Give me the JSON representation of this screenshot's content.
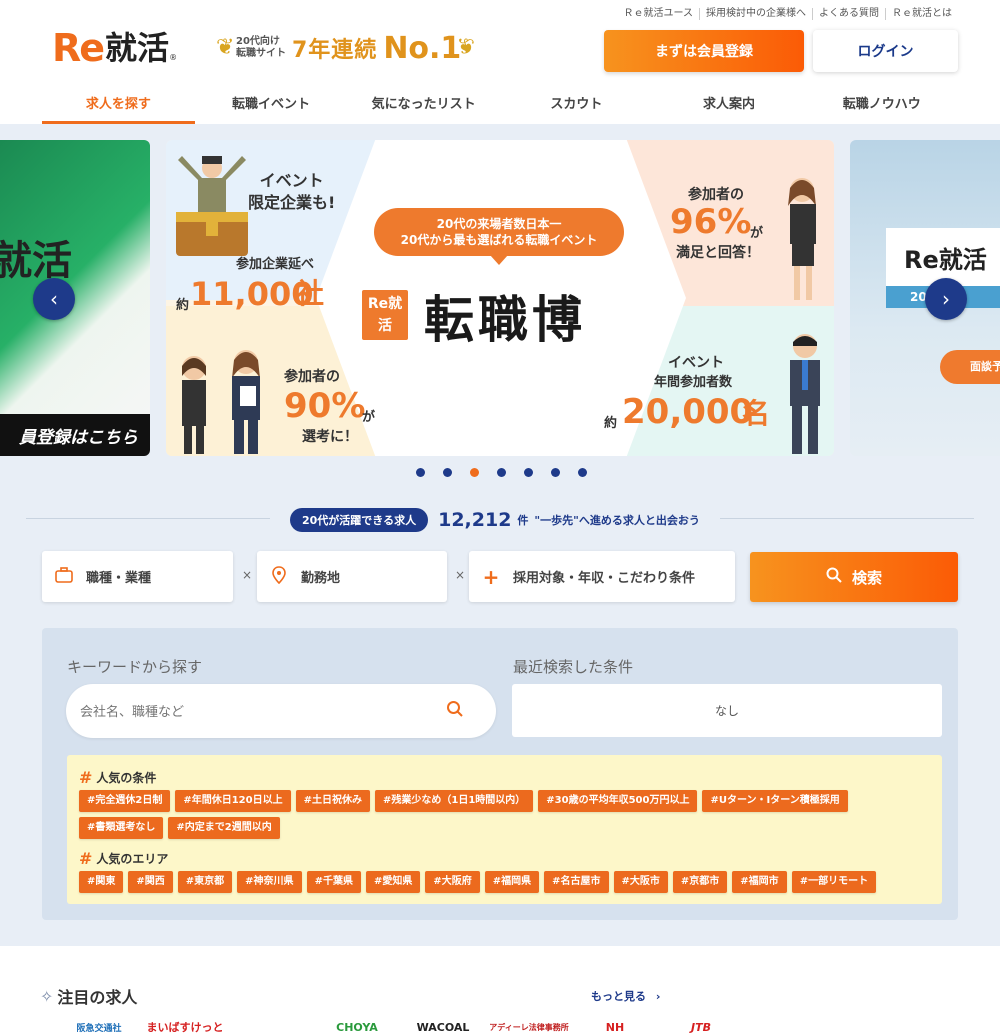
{
  "util_links": [
    "Ｒｅ就活ユース",
    "採用検討中の企業様へ",
    "よくある質問",
    "Ｒｅ就活とは"
  ],
  "logo": {
    "re": "Re",
    "kanji": "就活",
    "mark": "®"
  },
  "badge": {
    "line1": "20代向け",
    "line2": "転職サイト",
    "years": "7年連続",
    "no1": "No.1"
  },
  "header_buttons": {
    "register": "まずは会員登録",
    "login": "ログイン"
  },
  "nav": [
    {
      "label": "求人を探す",
      "active": true
    },
    {
      "label": "転職イベント",
      "active": false
    },
    {
      "label": "気になったリスト",
      "active": false
    },
    {
      "label": "スカウト",
      "active": false
    },
    {
      "label": "求人案内",
      "active": false
    },
    {
      "label": "転職ノウハウ",
      "active": false
    }
  ],
  "banner": {
    "left_logo": "就活",
    "left_cta": "員登録はこちら",
    "event_limited": "イベント\n限定企業も!",
    "companies_label": "参加企業延べ",
    "companies_prefix": "約",
    "companies_num": "11,000",
    "companies_unit": "社",
    "bubble_line1": "20代の来場者数日本一",
    "bubble_line2": "20代から最も選ばれる転職イベント",
    "tenshoku_logo": "Re就活",
    "tenshoku_text": "転職博",
    "satisfaction_label": "参加者の",
    "satisfaction_num": "96%",
    "satisfaction_suffix": "が",
    "satisfaction_tail": "満足と回答！",
    "selection_label": "参加者の",
    "selection_num": "90%",
    "selection_suffix": "が",
    "selection_tail": "選考に！",
    "annual_label1": "イベント",
    "annual_label2": "年間参加者数",
    "annual_prefix": "約",
    "annual_num": "20,000",
    "annual_unit": "名",
    "right_logo": "Re就活",
    "right_bar": "20代",
    "right_btn": "面談予"
  },
  "carousel": {
    "prev_icon": "chevron-left-icon",
    "next_icon": "chevron-right-icon",
    "dot_count": 7,
    "active_dot": 2
  },
  "job_count": {
    "pill": "20代が活躍できる求人",
    "number": "12,212",
    "unit": "件",
    "text": "\"一歩先\"へ進める求人と出会おう"
  },
  "search": {
    "job_type": "職種・業種",
    "location": "勤務地",
    "conditions": "採用対象・年収・こだわり条件",
    "times": "×",
    "button": "検索"
  },
  "keyword": {
    "label": "キーワードから探す",
    "placeholder": "会社名、職種など",
    "recent_label": "最近検索した条件",
    "recent_value": "なし"
  },
  "popular_conditions": {
    "heading": "人気の条件",
    "tags": [
      "#完全週休2日制",
      "#年間休日120日以上",
      "#土日祝休み",
      "#残業少なめ（1日1時間以内）",
      "#30歳の平均年収500万円以上",
      "#Uターン・Iターン積極採用",
      "#書類選考なし",
      "#内定まで2週間以内"
    ]
  },
  "popular_areas": {
    "heading": "人気のエリア",
    "tags": [
      "#関東",
      "#関西",
      "#東京都",
      "#神奈川県",
      "#千葉県",
      "#愛知県",
      "#大阪府",
      "#福岡県",
      "#名古屋市",
      "#大阪市",
      "#京都市",
      "#福岡市",
      "#一部リモート"
    ]
  },
  "featured": {
    "title": "注目の求人",
    "more": "もっと見る",
    "companies": [
      "阪急交通社",
      "まいばすけっと",
      "",
      "CHOYA",
      "WACOAL",
      "アディーレ法律事務所",
      "NH",
      "JTB"
    ]
  },
  "colors": {
    "accent": "#ef6c1c",
    "navy": "#1e3a8a",
    "panel": "#d6e1ee",
    "hero_bg": "#e8eef6",
    "tag_bg": "#fdf7c9"
  }
}
